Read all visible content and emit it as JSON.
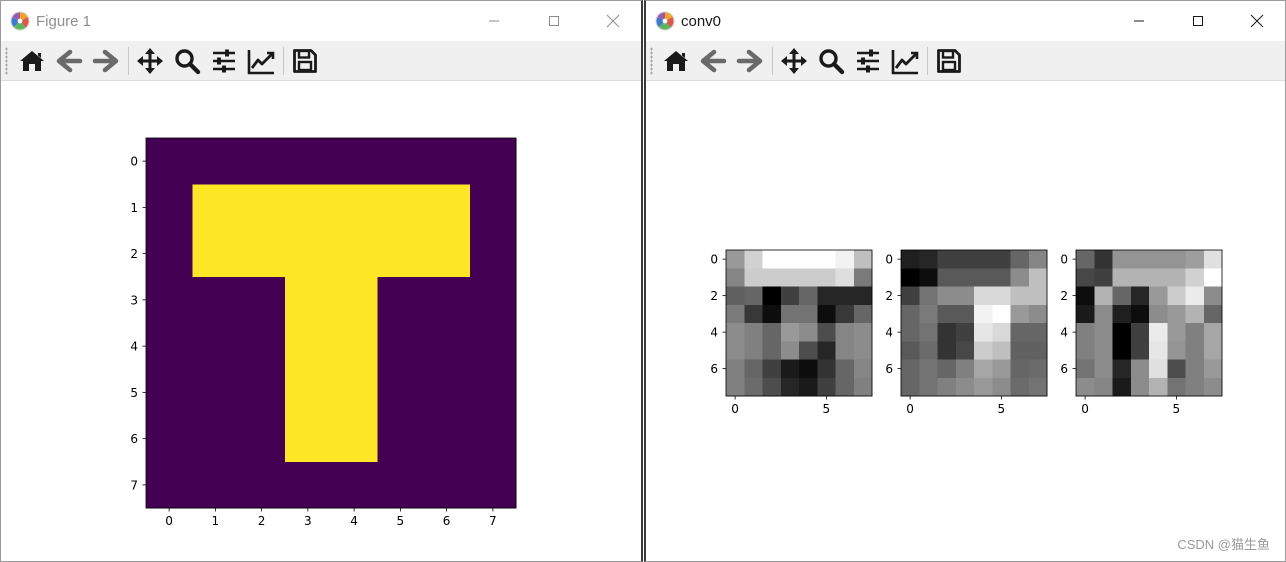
{
  "windows": {
    "left": {
      "title": "Figure 1",
      "toolbar": [
        "home-icon",
        "back-arrow-icon",
        "forward-arrow-icon",
        "pan-icon",
        "zoom-icon",
        "configure-subplots-icon",
        "edit-axes-icon",
        "save-icon"
      ],
      "controls": [
        "minimize-icon",
        "maximize-icon",
        "close-icon"
      ]
    },
    "right": {
      "title": "conv0",
      "toolbar": [
        "home-icon",
        "back-arrow-icon",
        "forward-arrow-icon",
        "pan-icon",
        "zoom-icon",
        "configure-subplots-icon",
        "edit-axes-icon",
        "save-icon"
      ],
      "controls": [
        "minimize-icon",
        "maximize-icon",
        "close-icon"
      ]
    }
  },
  "colors": {
    "viridis_low": "#440154",
    "viridis_high": "#fde725",
    "toolbar_bg": "#f0f0f0",
    "icon_dark": "#1a1a1a",
    "icon_disabled": "#6a6a6a"
  },
  "chart_data": [
    {
      "type": "heatmap",
      "colormap": "viridis",
      "rows": [
        [
          0,
          0,
          0,
          0,
          0,
          0,
          0,
          0
        ],
        [
          0,
          1,
          1,
          1,
          1,
          1,
          1,
          0
        ],
        [
          0,
          1,
          1,
          1,
          1,
          1,
          1,
          0
        ],
        [
          0,
          0,
          0,
          1,
          1,
          0,
          0,
          0
        ],
        [
          0,
          0,
          0,
          1,
          1,
          0,
          0,
          0
        ],
        [
          0,
          0,
          0,
          1,
          1,
          0,
          0,
          0
        ],
        [
          0,
          0,
          0,
          1,
          1,
          0,
          0,
          0
        ],
        [
          0,
          0,
          0,
          0,
          0,
          0,
          0,
          0
        ]
      ],
      "xticks": [
        "0",
        "1",
        "2",
        "3",
        "4",
        "5",
        "6",
        "7"
      ],
      "yticks": [
        "0",
        "1",
        "2",
        "3",
        "4",
        "5",
        "6",
        "7"
      ]
    },
    {
      "type": "heatmap",
      "colormap": "gray",
      "rows": [
        [
          0.6,
          0.82,
          1.0,
          1.0,
          1.0,
          1.0,
          0.95,
          0.75
        ],
        [
          0.52,
          0.8,
          0.8,
          0.8,
          0.8,
          0.8,
          0.87,
          0.48
        ],
        [
          0.38,
          0.4,
          0.0,
          0.25,
          0.4,
          0.15,
          0.15,
          0.15
        ],
        [
          0.48,
          0.22,
          0.05,
          0.45,
          0.45,
          0.05,
          0.22,
          0.4
        ],
        [
          0.55,
          0.5,
          0.4,
          0.6,
          0.55,
          0.3,
          0.52,
          0.55
        ],
        [
          0.55,
          0.5,
          0.4,
          0.55,
          0.3,
          0.15,
          0.52,
          0.55
        ],
        [
          0.5,
          0.4,
          0.25,
          0.1,
          0.05,
          0.2,
          0.4,
          0.52
        ],
        [
          0.5,
          0.42,
          0.3,
          0.15,
          0.1,
          0.25,
          0.4,
          0.5
        ]
      ],
      "xticks": [
        "0",
        "5"
      ],
      "yticks": [
        "0",
        "2",
        "4",
        "6"
      ]
    },
    {
      "type": "heatmap",
      "colormap": "gray",
      "rows": [
        [
          0.12,
          0.15,
          0.25,
          0.25,
          0.25,
          0.25,
          0.4,
          0.52
        ],
        [
          0.0,
          0.05,
          0.35,
          0.35,
          0.35,
          0.35,
          0.55,
          0.75
        ],
        [
          0.25,
          0.45,
          0.55,
          0.55,
          0.85,
          0.85,
          0.75,
          0.75
        ],
        [
          0.4,
          0.48,
          0.35,
          0.35,
          0.95,
          1.0,
          0.6,
          0.55
        ],
        [
          0.4,
          0.45,
          0.2,
          0.25,
          0.9,
          0.85,
          0.4,
          0.4
        ],
        [
          0.35,
          0.42,
          0.2,
          0.28,
          0.8,
          0.75,
          0.38,
          0.38
        ],
        [
          0.4,
          0.45,
          0.4,
          0.5,
          0.65,
          0.6,
          0.4,
          0.42
        ],
        [
          0.4,
          0.45,
          0.5,
          0.55,
          0.6,
          0.55,
          0.42,
          0.45
        ]
      ],
      "xticks": [
        "0",
        "5"
      ],
      "yticks": [
        "0",
        "2",
        "4",
        "6"
      ]
    },
    {
      "type": "heatmap",
      "colormap": "gray",
      "rows": [
        [
          0.4,
          0.2,
          0.58,
          0.58,
          0.58,
          0.58,
          0.62,
          0.88
        ],
        [
          0.28,
          0.25,
          0.7,
          0.7,
          0.7,
          0.7,
          0.82,
          1.0
        ],
        [
          0.05,
          0.7,
          0.4,
          0.15,
          0.6,
          0.8,
          0.92,
          0.55
        ],
        [
          0.1,
          0.55,
          0.12,
          0.05,
          0.55,
          0.6,
          0.7,
          0.4
        ],
        [
          0.5,
          0.55,
          0.0,
          0.25,
          0.92,
          0.6,
          0.5,
          0.65
        ],
        [
          0.5,
          0.55,
          0.0,
          0.25,
          0.9,
          0.58,
          0.5,
          0.65
        ],
        [
          0.45,
          0.55,
          0.15,
          0.55,
          0.88,
          0.3,
          0.5,
          0.6
        ],
        [
          0.55,
          0.52,
          0.1,
          0.55,
          0.7,
          0.45,
          0.5,
          0.55
        ]
      ],
      "xticks": [
        "0",
        "5"
      ],
      "yticks": [
        "0",
        "2",
        "4",
        "6"
      ]
    }
  ],
  "watermark": "CSDN @猫生鱼"
}
